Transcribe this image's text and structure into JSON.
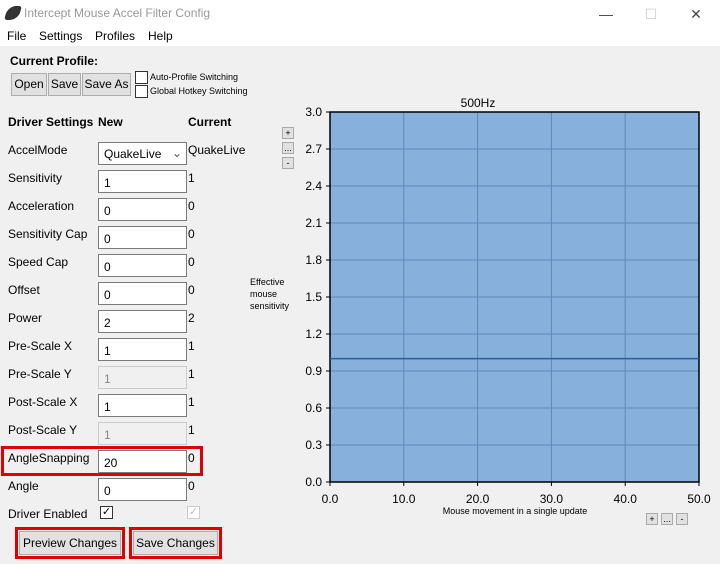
{
  "window": {
    "title": "Intercept Mouse Accel Filter Config",
    "app_icon": "mouse-logo-icon"
  },
  "menu": [
    "File",
    "Settings",
    "Profiles",
    "Help"
  ],
  "profile": {
    "heading": "Current Profile:",
    "open": "Open",
    "save": "Save",
    "save_as": "Save As",
    "auto_switch": "Auto-Profile Switching",
    "auto_switch_checked": false,
    "hotkey_switch": "Global Hotkey Switching",
    "hotkey_switch_checked": false
  },
  "settings": {
    "headers": {
      "name": "Driver Settings",
      "new": "New",
      "current": "Current"
    },
    "accel_mode": {
      "label": "AccelMode",
      "new": "QuakeLive",
      "current": "QuakeLive"
    },
    "rows": [
      {
        "label": "Sensitivity",
        "new": "1",
        "current": "1",
        "disabled": false
      },
      {
        "label": "Acceleration",
        "new": "0",
        "current": "0",
        "disabled": false
      },
      {
        "label": "Sensitivity Cap",
        "new": "0",
        "current": "0",
        "disabled": false
      },
      {
        "label": "Speed Cap",
        "new": "0",
        "current": "0",
        "disabled": false
      },
      {
        "label": "Offset",
        "new": "0",
        "current": "0",
        "disabled": false
      },
      {
        "label": "Power",
        "new": "2",
        "current": "2",
        "disabled": false
      },
      {
        "label": "Pre-Scale X",
        "new": "1",
        "current": "1",
        "disabled": false
      },
      {
        "label": "Pre-Scale Y",
        "new": "1",
        "current": "1",
        "disabled": true
      },
      {
        "label": "Post-Scale X",
        "new": "1",
        "current": "1",
        "disabled": false
      },
      {
        "label": "Post-Scale Y",
        "new": "1",
        "current": "1",
        "disabled": true
      },
      {
        "label": "AngleSnapping",
        "new": "20",
        "current": "0",
        "disabled": false
      },
      {
        "label": "Angle",
        "new": "0",
        "current": "0",
        "disabled": false
      }
    ],
    "driver_enabled": {
      "label": "Driver Enabled",
      "new": true,
      "current": true
    },
    "preview": "Preview Changes",
    "save": "Save Changes",
    "highlight_color": "#e00000"
  },
  "zoom_buttons": {
    "plus": "+",
    "more": "...",
    "minus": "-"
  },
  "chart_data": {
    "type": "line",
    "title": "500Hz",
    "xlabel": "Mouse movement in a single update",
    "ylabel": "Effective mouse sensitivity",
    "xlim": [
      0,
      50
    ],
    "ylim": [
      0,
      3
    ],
    "xticks": [
      "0.0",
      "10.0",
      "20.0",
      "30.0",
      "40.0",
      "50.0"
    ],
    "yticks": [
      "0.0",
      "0.3",
      "0.6",
      "0.9",
      "1.2",
      "1.5",
      "1.8",
      "2.1",
      "2.4",
      "2.7",
      "3.0"
    ],
    "grid": true,
    "background": "#87b0dc",
    "line_color": "#2a5c9e",
    "series": [
      {
        "x": [
          0,
          50
        ],
        "y": [
          1.0,
          1.0
        ]
      }
    ]
  }
}
